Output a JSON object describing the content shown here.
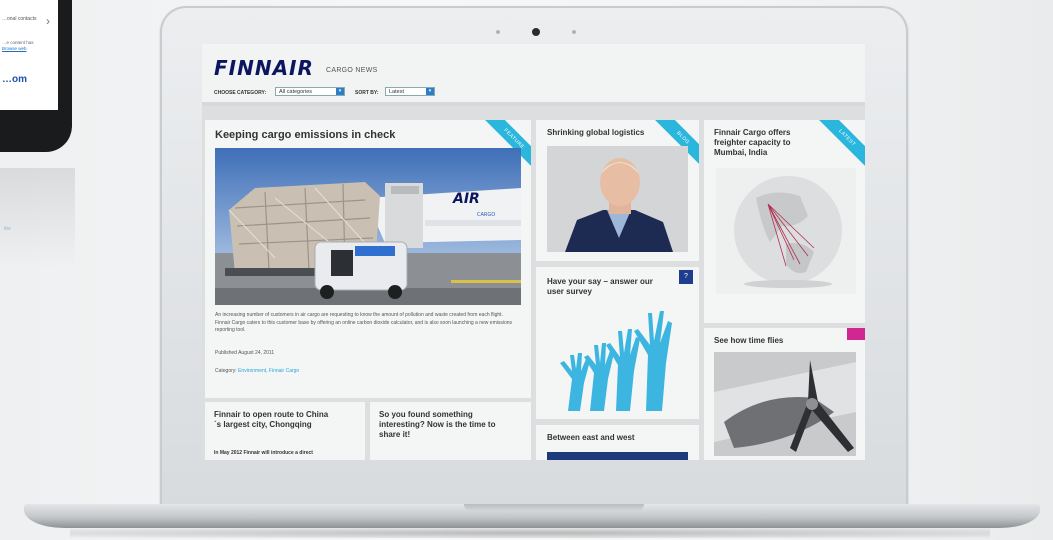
{
  "phone": {
    "row_label": "…onal contacts",
    "note_line1": "…e content has",
    "note_link": "Browse web",
    "link_text": "…om",
    "reflect_text": "the"
  },
  "site": {
    "logo": "FINNAIR",
    "section": "CARGO NEWS",
    "filters": {
      "category_label": "CHOOSE CATEGORY:",
      "category_value": "All categories",
      "sort_label": "SORT BY:",
      "sort_value": "Latest"
    }
  },
  "colors": {
    "brand_navy": "#0b1560",
    "ribbon_cyan": "#2bb6de",
    "ribbon_navy": "#1d3d8f",
    "ribbon_magenta": "#d02890",
    "hands": "#3cb6e0"
  },
  "cards": {
    "feature": {
      "title": "Keeping cargo emissions in check",
      "ribbon": "FEATURE",
      "body": "An increasing number of customers in air cargo are requesting to know the amount of pollution and waste created from each flight. Finnair Cargo caters to this customer base by offering an online carbon dioxide calculator, and is also soon launching a new emissions reporting tool.",
      "published": "Published August 24, 2011",
      "category_label": "Category:",
      "category_links": "Environment, Finnair Cargo",
      "photo_text": "AIR",
      "photo_sub": "CARGO"
    },
    "blog": {
      "title": "Shrinking global logistics",
      "ribbon": "BLOG"
    },
    "latest": {
      "title": "Finnair Cargo offers freighter capacity to Mumbai, India",
      "ribbon": "LATEST"
    },
    "survey": {
      "title": "Have your say – answer our user survey",
      "badge": "?"
    },
    "time": {
      "title": "See how time flies"
    },
    "route": {
      "title": "Finnair to open route to China´s largest city, Chongqing",
      "body": "In May 2012 Finnair will introduce a direct"
    },
    "share": {
      "title": "So you found something interesting? Now is the time to share it!"
    },
    "east": {
      "title": "Between east and west"
    }
  }
}
